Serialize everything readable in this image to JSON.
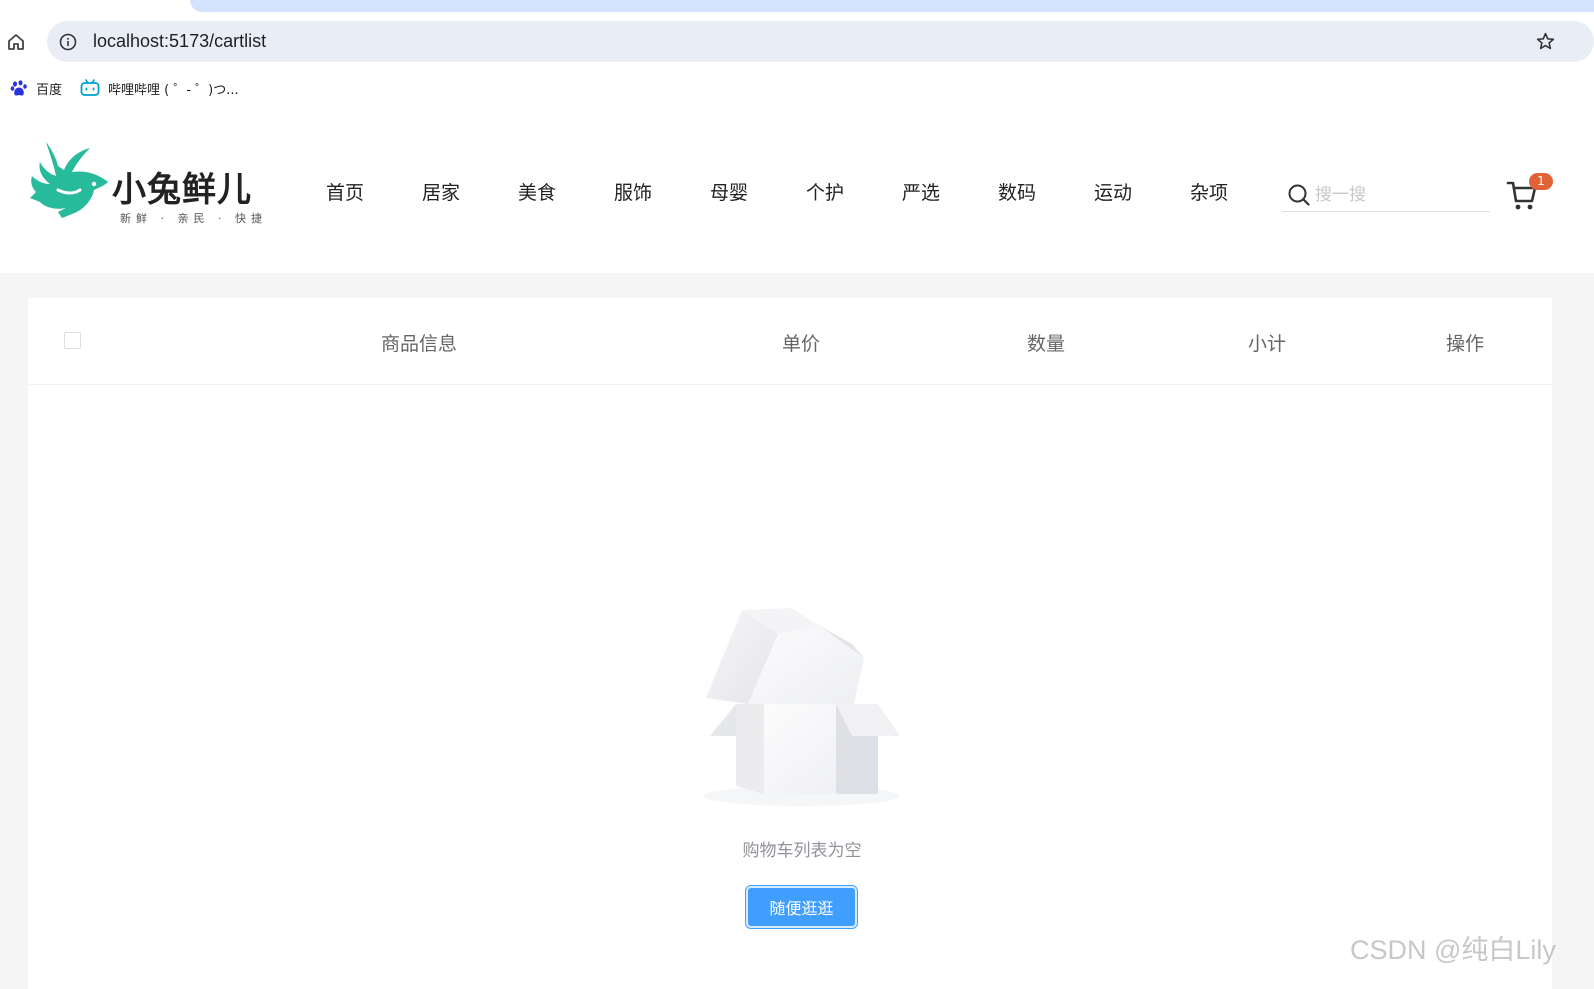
{
  "browser": {
    "url": "localhost:5173/cartlist",
    "bookmarks": [
      {
        "label": "百度",
        "icon": "baidu-paw-icon"
      },
      {
        "label": "哔哩哔哩 ( ゜- ゜)つ...",
        "icon": "bilibili-tv-icon"
      }
    ]
  },
  "header": {
    "logo_text": "小兔鲜儿",
    "logo_slogan": "新鲜 · 亲民 · 快捷",
    "nav": [
      "首页",
      "居家",
      "美食",
      "服饰",
      "母婴",
      "个护",
      "严选",
      "数码",
      "运动",
      "杂项"
    ],
    "search_placeholder": "搜一搜",
    "cart_count": "1"
  },
  "cart": {
    "columns": {
      "goods": "商品信息",
      "price": "单价",
      "quantity": "数量",
      "subtotal": "小计",
      "action": "操作"
    },
    "empty_text": "购物车列表为空",
    "browse_button": "随便逛逛"
  },
  "watermark": "CSDN @纯白Lily",
  "colors": {
    "brand_green": "#27ba9b",
    "primary_button": "#409eff",
    "badge": "#e26237",
    "page_bg": "#f5f5f5"
  }
}
